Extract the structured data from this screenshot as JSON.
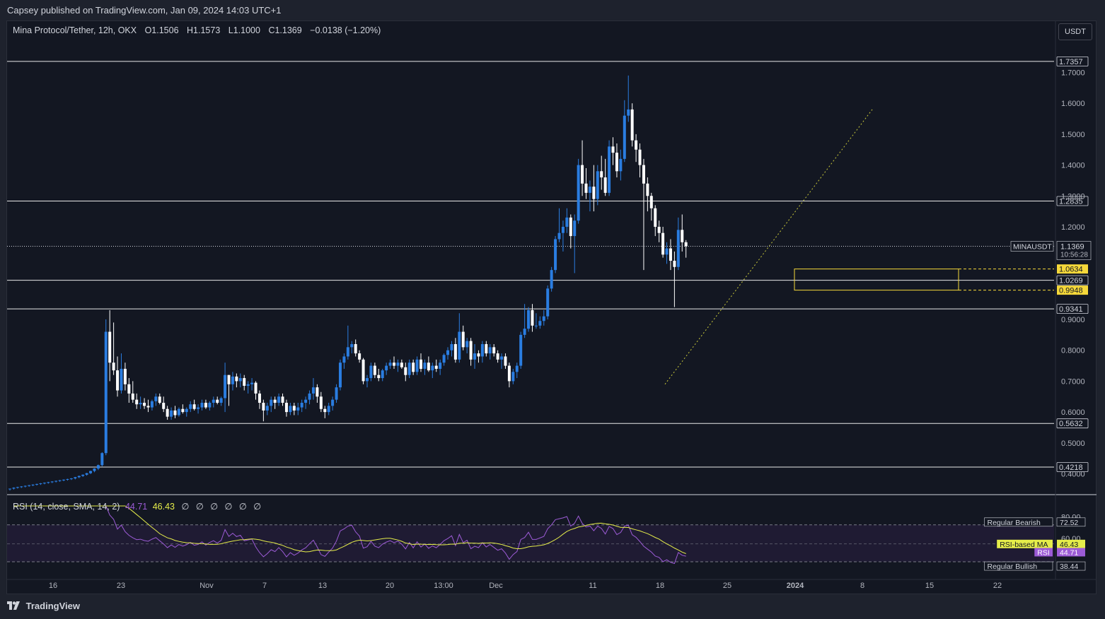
{
  "header": {
    "published": "Capsey published on TradingView.com, Jan 09, 2024 14:03 UTC+1"
  },
  "legend": {
    "symbol": "Mina Protocol/Tether, 12h, OKX",
    "open": "O1.1506",
    "high": "H1.1573",
    "low": "L1.1000",
    "close": "C1.1369",
    "change": "−0.0138 (−1.20%)"
  },
  "currency_button": "USDT",
  "rsi_legend": {
    "label": "RSI (14, close, SMA, 14, 2)",
    "rsi_value": "44.71",
    "ma_value": "46.43",
    "dots": "∅ ∅ ∅ ∅ ∅ ∅"
  },
  "footer": {
    "brand": "TradingView"
  },
  "colors": {
    "background": "#131722",
    "up": "#2a7de1",
    "down": "#ffffff",
    "rsi": "#9c5bd6",
    "rsi_ma": "#e5ed4a",
    "zone": "#f5d83a"
  },
  "chart_data": {
    "type": "candlestick",
    "symbol": "MINAUSDT",
    "timeframe": "12h",
    "exchange": "OKX",
    "y_axis": {
      "range": [
        0.3,
        1.8
      ],
      "ticks": [
        "0.4000",
        "0.5000",
        "0.6000",
        "0.7000",
        "0.8000",
        "0.9000",
        "1.2000",
        "1.3000",
        "1.4000",
        "1.5000",
        "1.6000",
        "1.7000"
      ],
      "tick_values": [
        0.4,
        0.5,
        0.6,
        0.7,
        0.8,
        0.9,
        1.2,
        1.3,
        1.4,
        1.5,
        1.6,
        1.7
      ]
    },
    "x_axis": {
      "labels": [
        "16",
        "23",
        "Nov",
        "7",
        "13",
        "20",
        "13:00",
        "Dec",
        "11",
        "18",
        "25",
        "2024",
        "8",
        "15",
        "22"
      ]
    },
    "horizontal_levels": [
      1.7357,
      1.2835,
      1.0269,
      0.9341,
      0.5632,
      0.4218
    ],
    "level_labels": [
      "1.7357",
      "1.2835",
      "1.0269",
      "0.9341",
      "0.5632",
      "0.4218"
    ],
    "zone": {
      "top": 1.0634,
      "bottom": 0.9948,
      "top_label": "1.0634",
      "bottom_label": "0.9948"
    },
    "last_price": {
      "symbol": "MINAUSDT",
      "value": "1.1369",
      "countdown": "10:56:28",
      "numeric": 1.1369
    },
    "trendline": {
      "from_value": 0.69,
      "to_value": 1.58
    },
    "candles": [
      [
        0.35,
        0.352,
        0.346,
        0.352
      ],
      [
        0.352,
        0.356,
        0.349,
        0.355
      ],
      [
        0.355,
        0.358,
        0.352,
        0.357
      ],
      [
        0.357,
        0.36,
        0.354,
        0.359
      ],
      [
        0.359,
        0.362,
        0.356,
        0.361
      ],
      [
        0.361,
        0.364,
        0.358,
        0.363
      ],
      [
        0.363,
        0.366,
        0.36,
        0.365
      ],
      [
        0.365,
        0.368,
        0.362,
        0.367
      ],
      [
        0.367,
        0.37,
        0.364,
        0.369
      ],
      [
        0.369,
        0.372,
        0.366,
        0.371
      ],
      [
        0.371,
        0.374,
        0.368,
        0.373
      ],
      [
        0.373,
        0.376,
        0.37,
        0.375
      ],
      [
        0.375,
        0.378,
        0.372,
        0.377
      ],
      [
        0.377,
        0.38,
        0.374,
        0.379
      ],
      [
        0.379,
        0.382,
        0.376,
        0.381
      ],
      [
        0.381,
        0.384,
        0.378,
        0.383
      ],
      [
        0.383,
        0.386,
        0.38,
        0.385
      ],
      [
        0.385,
        0.39,
        0.382,
        0.389
      ],
      [
        0.389,
        0.394,
        0.386,
        0.393
      ],
      [
        0.393,
        0.398,
        0.39,
        0.397
      ],
      [
        0.397,
        0.403,
        0.394,
        0.402
      ],
      [
        0.402,
        0.41,
        0.399,
        0.409
      ],
      [
        0.409,
        0.418,
        0.405,
        0.417
      ],
      [
        0.417,
        0.43,
        0.412,
        0.428
      ],
      [
        0.428,
        0.47,
        0.424,
        0.467
      ],
      [
        0.467,
        0.9,
        0.46,
        0.86
      ],
      [
        0.86,
        0.93,
        0.7,
        0.76
      ],
      [
        0.76,
        0.89,
        0.72,
        0.735
      ],
      [
        0.735,
        0.78,
        0.65,
        0.67
      ],
      [
        0.67,
        0.79,
        0.66,
        0.74
      ],
      [
        0.74,
        0.76,
        0.67,
        0.69
      ],
      [
        0.69,
        0.71,
        0.63,
        0.66
      ],
      [
        0.66,
        0.7,
        0.63,
        0.64
      ],
      [
        0.64,
        0.66,
        0.61,
        0.625
      ],
      [
        0.625,
        0.65,
        0.61,
        0.63
      ],
      [
        0.63,
        0.645,
        0.61,
        0.62
      ],
      [
        0.62,
        0.64,
        0.6,
        0.615
      ],
      [
        0.615,
        0.64,
        0.605,
        0.635
      ],
      [
        0.635,
        0.66,
        0.62,
        0.65
      ],
      [
        0.65,
        0.66,
        0.625,
        0.63
      ],
      [
        0.63,
        0.65,
        0.6,
        0.61
      ],
      [
        0.61,
        0.62,
        0.575,
        0.585
      ],
      [
        0.585,
        0.615,
        0.575,
        0.605
      ],
      [
        0.605,
        0.62,
        0.58,
        0.59
      ],
      [
        0.59,
        0.615,
        0.585,
        0.61
      ],
      [
        0.61,
        0.625,
        0.595,
        0.6
      ],
      [
        0.6,
        0.615,
        0.585,
        0.61
      ],
      [
        0.61,
        0.635,
        0.6,
        0.625
      ],
      [
        0.625,
        0.64,
        0.605,
        0.61
      ],
      [
        0.61,
        0.625,
        0.595,
        0.615
      ],
      [
        0.615,
        0.64,
        0.605,
        0.63
      ],
      [
        0.63,
        0.64,
        0.61,
        0.615
      ],
      [
        0.615,
        0.635,
        0.605,
        0.63
      ],
      [
        0.63,
        0.65,
        0.615,
        0.64
      ],
      [
        0.64,
        0.65,
        0.625,
        0.63
      ],
      [
        0.63,
        0.65,
        0.62,
        0.645
      ],
      [
        0.645,
        0.76,
        0.6,
        0.72
      ],
      [
        0.72,
        0.72,
        0.62,
        0.69
      ],
      [
        0.69,
        0.73,
        0.67,
        0.715
      ],
      [
        0.715,
        0.725,
        0.68,
        0.7
      ],
      [
        0.7,
        0.725,
        0.68,
        0.71
      ],
      [
        0.71,
        0.72,
        0.67,
        0.685
      ],
      [
        0.685,
        0.7,
        0.66,
        0.69
      ],
      [
        0.69,
        0.71,
        0.67,
        0.695
      ],
      [
        0.695,
        0.7,
        0.64,
        0.66
      ],
      [
        0.66,
        0.67,
        0.61,
        0.63
      ],
      [
        0.63,
        0.64,
        0.57,
        0.605
      ],
      [
        0.605,
        0.63,
        0.59,
        0.62
      ],
      [
        0.62,
        0.65,
        0.6,
        0.64
      ],
      [
        0.64,
        0.65,
        0.61,
        0.63
      ],
      [
        0.63,
        0.66,
        0.62,
        0.65
      ],
      [
        0.65,
        0.66,
        0.62,
        0.63
      ],
      [
        0.63,
        0.64,
        0.585,
        0.6
      ],
      [
        0.6,
        0.63,
        0.59,
        0.62
      ],
      [
        0.62,
        0.63,
        0.59,
        0.605
      ],
      [
        0.605,
        0.63,
        0.59,
        0.615
      ],
      [
        0.615,
        0.64,
        0.6,
        0.63
      ],
      [
        0.63,
        0.65,
        0.61,
        0.64
      ],
      [
        0.64,
        0.67,
        0.625,
        0.66
      ],
      [
        0.66,
        0.71,
        0.64,
        0.68
      ],
      [
        0.68,
        0.69,
        0.63,
        0.65
      ],
      [
        0.65,
        0.665,
        0.6,
        0.61
      ],
      [
        0.61,
        0.62,
        0.58,
        0.6
      ],
      [
        0.6,
        0.63,
        0.59,
        0.62
      ],
      [
        0.62,
        0.65,
        0.605,
        0.64
      ],
      [
        0.64,
        0.69,
        0.63,
        0.68
      ],
      [
        0.68,
        0.77,
        0.67,
        0.76
      ],
      [
        0.76,
        0.79,
        0.74,
        0.78
      ],
      [
        0.78,
        0.88,
        0.77,
        0.81
      ],
      [
        0.81,
        0.83,
        0.79,
        0.82
      ],
      [
        0.82,
        0.835,
        0.78,
        0.79
      ],
      [
        0.79,
        0.8,
        0.76,
        0.77
      ],
      [
        0.77,
        0.775,
        0.69,
        0.7
      ],
      [
        0.7,
        0.72,
        0.68,
        0.71
      ],
      [
        0.71,
        0.76,
        0.7,
        0.75
      ],
      [
        0.75,
        0.76,
        0.71,
        0.72
      ],
      [
        0.72,
        0.74,
        0.7,
        0.71
      ],
      [
        0.71,
        0.74,
        0.7,
        0.735
      ],
      [
        0.735,
        0.76,
        0.72,
        0.75
      ],
      [
        0.75,
        0.77,
        0.74,
        0.76
      ],
      [
        0.76,
        0.78,
        0.74,
        0.75
      ],
      [
        0.75,
        0.77,
        0.73,
        0.76
      ],
      [
        0.76,
        0.77,
        0.74,
        0.745
      ],
      [
        0.745,
        0.76,
        0.7,
        0.72
      ],
      [
        0.72,
        0.77,
        0.71,
        0.76
      ],
      [
        0.76,
        0.77,
        0.72,
        0.73
      ],
      [
        0.73,
        0.78,
        0.72,
        0.77
      ],
      [
        0.77,
        0.79,
        0.73,
        0.74
      ],
      [
        0.74,
        0.77,
        0.72,
        0.76
      ],
      [
        0.76,
        0.78,
        0.73,
        0.735
      ],
      [
        0.735,
        0.76,
        0.71,
        0.75
      ],
      [
        0.75,
        0.77,
        0.73,
        0.74
      ],
      [
        0.74,
        0.77,
        0.72,
        0.76
      ],
      [
        0.76,
        0.79,
        0.75,
        0.785
      ],
      [
        0.785,
        0.81,
        0.77,
        0.8
      ],
      [
        0.8,
        0.83,
        0.78,
        0.82
      ],
      [
        0.82,
        0.84,
        0.76,
        0.77
      ],
      [
        0.77,
        0.92,
        0.76,
        0.86
      ],
      [
        0.86,
        0.88,
        0.8,
        0.81
      ],
      [
        0.81,
        0.84,
        0.79,
        0.83
      ],
      [
        0.83,
        0.84,
        0.75,
        0.77
      ],
      [
        0.77,
        0.82,
        0.74,
        0.79
      ],
      [
        0.79,
        0.8,
        0.76,
        0.78
      ],
      [
        0.78,
        0.83,
        0.76,
        0.82
      ],
      [
        0.82,
        0.83,
        0.78,
        0.79
      ],
      [
        0.79,
        0.82,
        0.77,
        0.81
      ],
      [
        0.81,
        0.82,
        0.78,
        0.79
      ],
      [
        0.79,
        0.8,
        0.76,
        0.77
      ],
      [
        0.77,
        0.79,
        0.74,
        0.78
      ],
      [
        0.78,
        0.79,
        0.74,
        0.75
      ],
      [
        0.75,
        0.76,
        0.68,
        0.7
      ],
      [
        0.7,
        0.74,
        0.69,
        0.73
      ],
      [
        0.73,
        0.76,
        0.71,
        0.75
      ],
      [
        0.75,
        0.86,
        0.74,
        0.85
      ],
      [
        0.85,
        0.95,
        0.84,
        0.87
      ],
      [
        0.87,
        0.94,
        0.86,
        0.93
      ],
      [
        0.93,
        0.95,
        0.86,
        0.88
      ],
      [
        0.88,
        0.92,
        0.87,
        0.88
      ],
      [
        0.88,
        0.91,
        0.87,
        0.895
      ],
      [
        0.895,
        0.93,
        0.88,
        0.91
      ],
      [
        0.91,
        1.01,
        0.9,
        1.0
      ],
      [
        1.0,
        1.07,
        0.99,
        1.06
      ],
      [
        1.06,
        1.17,
        1.05,
        1.16
      ],
      [
        1.16,
        1.26,
        1.15,
        1.18
      ],
      [
        1.18,
        1.22,
        1.12,
        1.2
      ],
      [
        1.2,
        1.26,
        1.18,
        1.23
      ],
      [
        1.23,
        1.24,
        1.13,
        1.17
      ],
      [
        1.17,
        1.24,
        1.05,
        1.22
      ],
      [
        1.22,
        1.42,
        1.21,
        1.4
      ],
      [
        1.4,
        1.48,
        1.3,
        1.34
      ],
      [
        1.34,
        1.39,
        1.29,
        1.31
      ],
      [
        1.31,
        1.35,
        1.25,
        1.33
      ],
      [
        1.33,
        1.4,
        1.25,
        1.29
      ],
      [
        1.29,
        1.4,
        1.27,
        1.38
      ],
      [
        1.38,
        1.43,
        1.32,
        1.36
      ],
      [
        1.36,
        1.42,
        1.3,
        1.31
      ],
      [
        1.31,
        1.48,
        1.3,
        1.46
      ],
      [
        1.46,
        1.49,
        1.4,
        1.44
      ],
      [
        1.44,
        1.47,
        1.36,
        1.38
      ],
      [
        1.38,
        1.45,
        1.35,
        1.42
      ],
      [
        1.42,
        1.61,
        1.41,
        1.56
      ],
      [
        1.56,
        1.69,
        1.54,
        1.58
      ],
      [
        1.58,
        1.6,
        1.46,
        1.48
      ],
      [
        1.48,
        1.5,
        1.41,
        1.45
      ],
      [
        1.45,
        1.47,
        1.36,
        1.4
      ],
      [
        1.4,
        1.42,
        1.06,
        1.34
      ],
      [
        1.34,
        1.36,
        1.25,
        1.3
      ],
      [
        1.3,
        1.31,
        1.22,
        1.26
      ],
      [
        1.26,
        1.27,
        1.17,
        1.2
      ],
      [
        1.2,
        1.22,
        1.15,
        1.18
      ],
      [
        1.18,
        1.2,
        1.1,
        1.11
      ],
      [
        1.11,
        1.15,
        1.08,
        1.13
      ],
      [
        1.13,
        1.16,
        1.06,
        1.09
      ],
      [
        1.09,
        1.12,
        0.94,
        1.07
      ],
      [
        1.07,
        1.23,
        1.06,
        1.19
      ],
      [
        1.19,
        1.24,
        1.12,
        1.15
      ],
      [
        1.15,
        1.157,
        1.1,
        1.137
      ]
    ],
    "rsi": {
      "label": "RSI (14, close, SMA, 14, 2)",
      "range": [
        0,
        100
      ],
      "levels": {
        "upper": 72.52,
        "lower": 38.44
      },
      "ticks": [
        "80.00",
        "60.00"
      ],
      "tick_values": [
        80,
        60
      ],
      "labels": {
        "regular_bearish": "Regular Bearish",
        "regular_bearish_value": "72.52",
        "rsi_ma": "RSI-based MA",
        "rsi_ma_value": "46.43",
        "rsi": "RSI",
        "rsi_value": "44.71",
        "regular_bullish": "Regular Bullish",
        "regular_bullish_value": "38.44"
      }
    }
  }
}
